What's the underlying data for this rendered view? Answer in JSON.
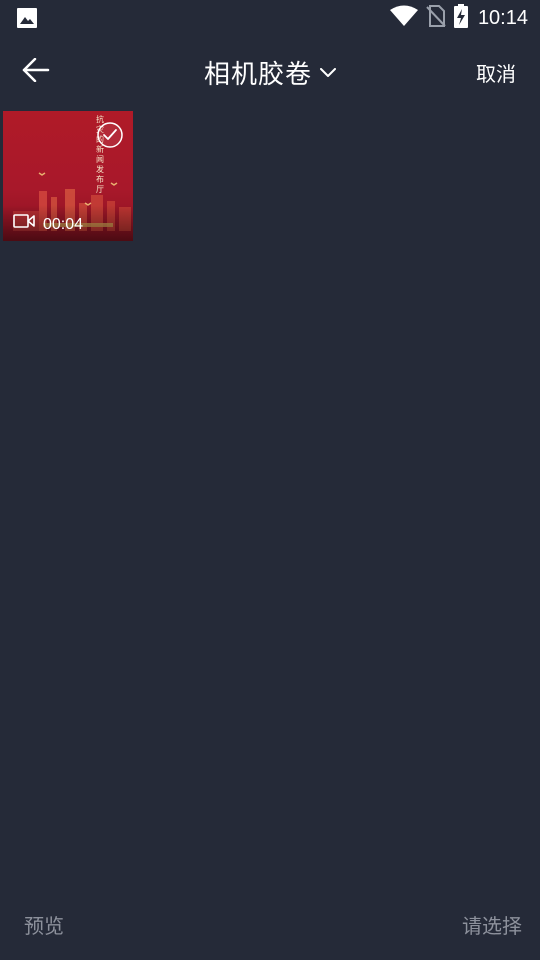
{
  "status_bar": {
    "time": "10:14",
    "icons": [
      "image-notification-icon",
      "wifi-icon",
      "no-sim-icon",
      "battery-charging-icon"
    ]
  },
  "header": {
    "title": "相机胶卷",
    "cancel_label": "取消",
    "icons": [
      "back-arrow-icon",
      "chevron-down-icon"
    ]
  },
  "grid": {
    "items": [
      {
        "type": "video",
        "duration": "00:04",
        "caption": "抗灾 的 新闻发布厅"
      }
    ]
  },
  "bottom_bar": {
    "preview_label": "预览",
    "select_status": "请选择"
  },
  "colors": {
    "background": "#252a38",
    "text_primary": "#ffffff",
    "text_disabled": "#8d919c",
    "thumb_red": "#b01a28"
  }
}
